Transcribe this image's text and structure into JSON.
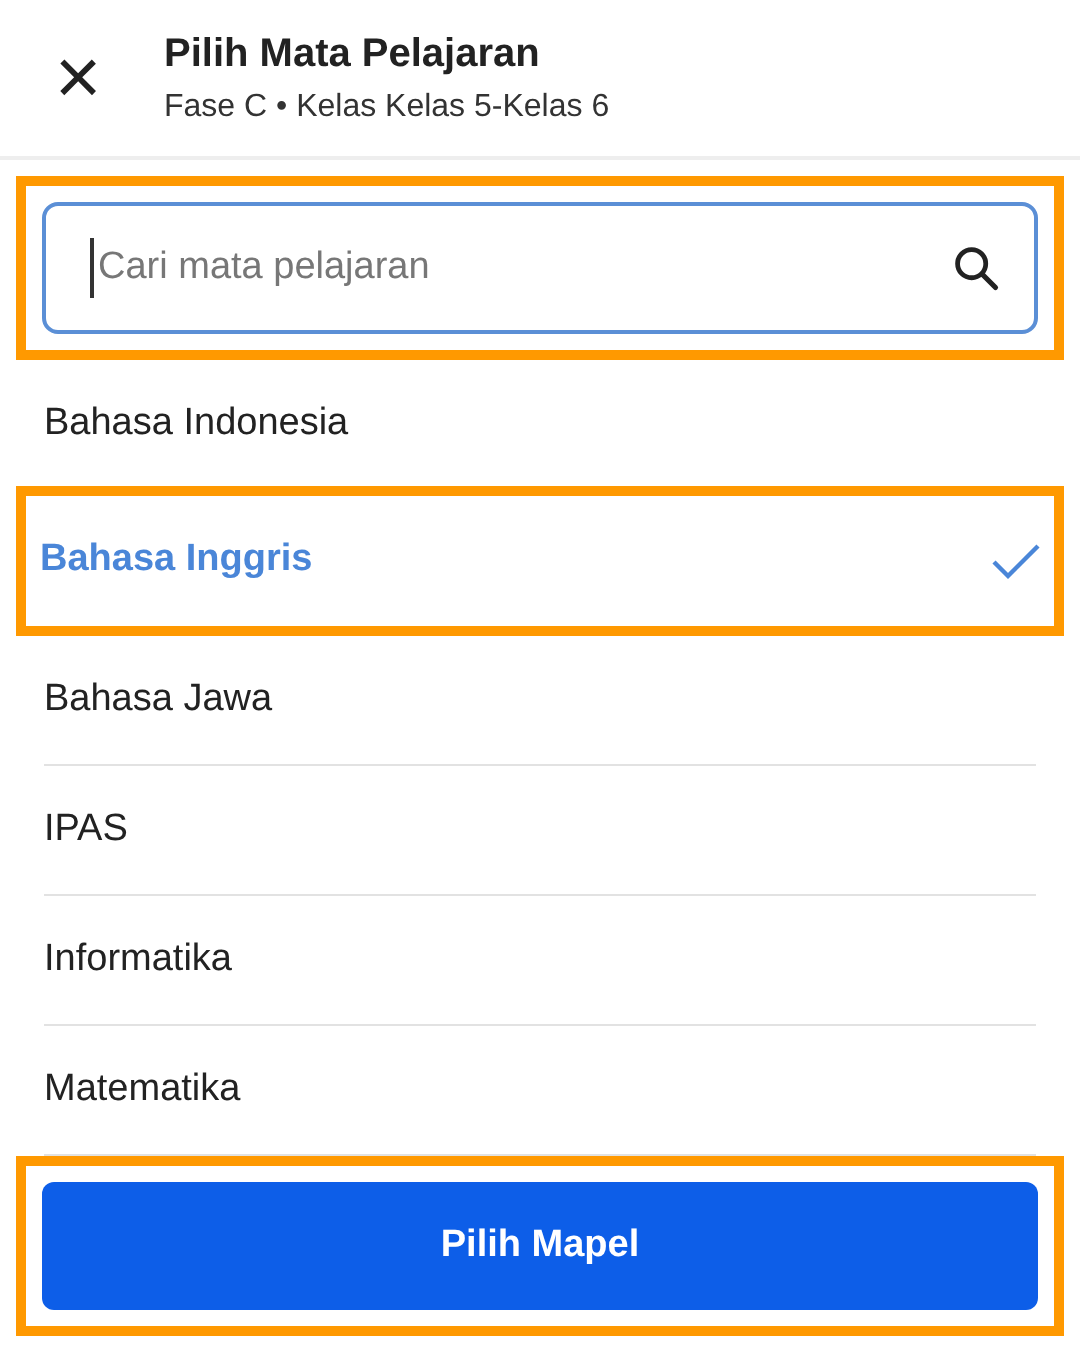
{
  "header": {
    "close_icon": "×",
    "title": "Pilih Mata Pelajaran",
    "subtitle": "Fase C • Kelas Kelas 5-Kelas 6"
  },
  "search": {
    "placeholder": "Cari mata pelajaran",
    "highlighted": true
  },
  "subjects": [
    {
      "label": "Bahasa Indonesia",
      "selected": false,
      "highlighted": false
    },
    {
      "label": "Bahasa Inggris",
      "selected": true,
      "highlighted": true
    },
    {
      "label": "Bahasa Jawa",
      "selected": false,
      "highlighted": false
    },
    {
      "label": "IPAS",
      "selected": false,
      "highlighted": false
    },
    {
      "label": "Informatika",
      "selected": false,
      "highlighted": false
    },
    {
      "label": "Matematika",
      "selected": false,
      "highlighted": false
    }
  ],
  "confirm_button": {
    "label": "Pilih Mapel",
    "highlighted": true
  }
}
